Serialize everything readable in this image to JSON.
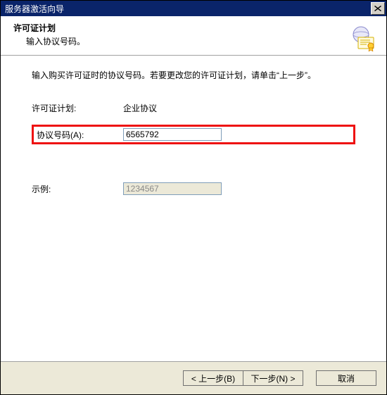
{
  "titlebar": {
    "title": "服务器激活向导"
  },
  "header": {
    "title": "许可证计划",
    "subtitle": "输入协议号码。"
  },
  "content": {
    "instruction": "输入购买许可证时的协议号码。若要更改您的许可证计划，请单击“上一步”。",
    "plan_label": "许可证计划:",
    "plan_value": "企业协议",
    "agreement_label": "协议号码(A):",
    "agreement_value": "6565792",
    "example_label": "示例:",
    "example_value": "1234567"
  },
  "footer": {
    "back": "< 上一步(B)",
    "next": "下一步(N) >",
    "cancel": "取消"
  }
}
